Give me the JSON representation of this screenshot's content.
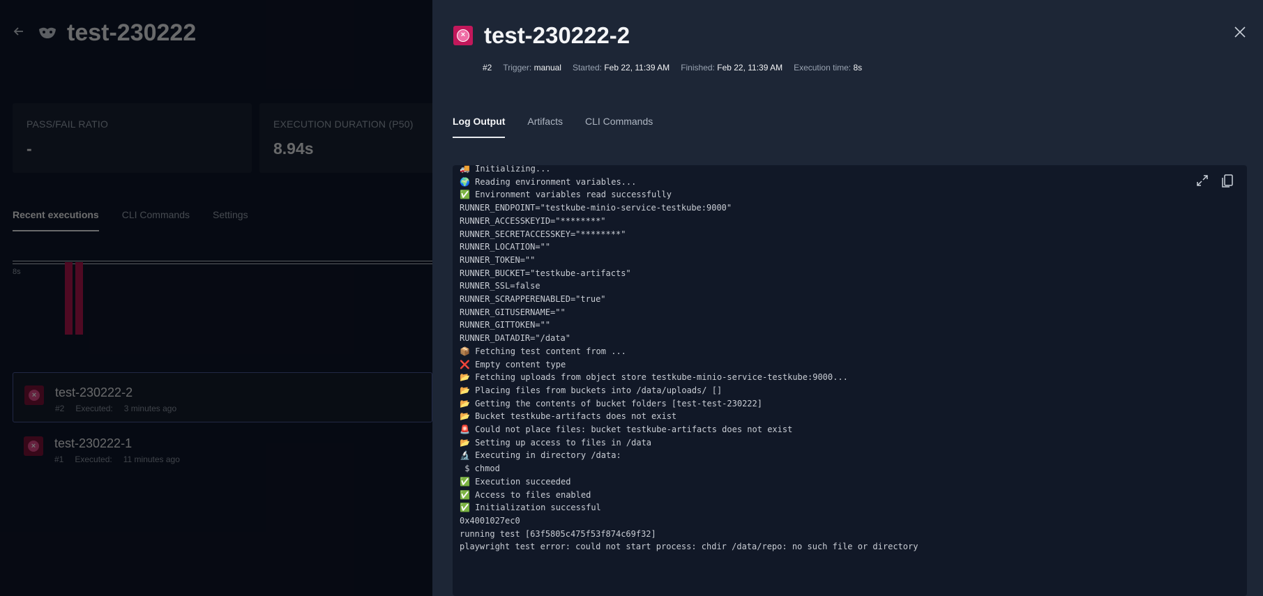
{
  "background": {
    "title": "test-230222",
    "metrics": [
      {
        "label": "PASS/FAIL RATIO",
        "value": "-"
      },
      {
        "label": "EXECUTION DURATION (P50)",
        "value": "8.94s"
      }
    ],
    "tabs": [
      "Recent executions",
      "CLI Commands",
      "Settings"
    ],
    "chart_tick": "8s",
    "executions": [
      {
        "name": "test-230222-2",
        "number": "#2",
        "executed_label": "Executed:",
        "executed": "3 minutes ago"
      },
      {
        "name": "test-230222-1",
        "number": "#1",
        "executed_label": "Executed:",
        "executed": "11 minutes ago"
      }
    ]
  },
  "drawer": {
    "title": "test-230222-2",
    "meta": {
      "number": "#2",
      "trigger_label": "Trigger:",
      "trigger": "manual",
      "started_label": "Started:",
      "started": "Feb 22, 11:39 AM",
      "finished_label": "Finished:",
      "finished": "Feb 22, 11:39 AM",
      "exec_time_label": "Execution time:",
      "exec_time": "8s"
    },
    "tabs": [
      "Log Output",
      "Artifacts",
      "CLI Commands"
    ],
    "log": [
      "🚚 Initializing...",
      "🌍 Reading environment variables...",
      "✅ Environment variables read successfully",
      "RUNNER_ENDPOINT=\"testkube-minio-service-testkube:9000\"",
      "RUNNER_ACCESSKEYID=\"********\"",
      "RUNNER_SECRETACCESSKEY=\"********\"",
      "RUNNER_LOCATION=\"\"",
      "RUNNER_TOKEN=\"\"",
      "RUNNER_BUCKET=\"testkube-artifacts\"",
      "RUNNER_SSL=false",
      "RUNNER_SCRAPPERENABLED=\"true\"",
      "RUNNER_GITUSERNAME=\"\"",
      "RUNNER_GITTOKEN=\"\"",
      "RUNNER_DATADIR=\"/data\"",
      "📦 Fetching test content from ...",
      "❌ Empty content type",
      "📂 Fetching uploads from object store testkube-minio-service-testkube:9000...",
      "📂 Placing files from buckets into /data/uploads/ []",
      "📂 Getting the contents of bucket folders [test-test-230222]",
      "📂 Bucket testkube-artifacts does not exist",
      "🚨 Could not place files: bucket testkube-artifacts does not exist",
      "📂 Setting up access to files in /data",
      "🔬 Executing in directory /data:",
      " $ chmod",
      "✅ Execution succeeded",
      "✅ Access to files enabled",
      "✅ Initialization successful",
      "0x4001027ec0",
      "running test [63f5805c475f53f874c69f32]",
      "playwright test error: could not start process: chdir /data/repo: no such file or directory"
    ]
  }
}
